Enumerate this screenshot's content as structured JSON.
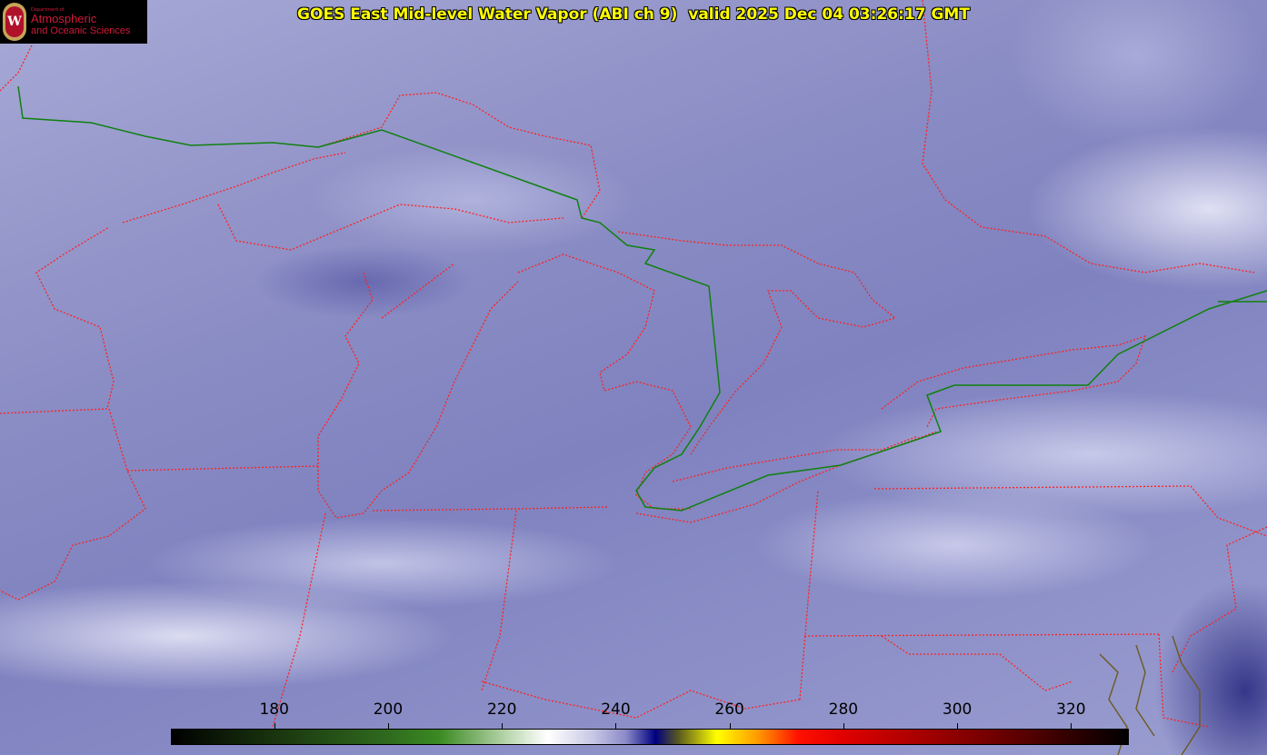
{
  "title": "GOES East Mid-level Water Vapor (ABI ch 9)  valid 2025 Dec 04 03:26:17 GMT",
  "logo": {
    "dept_line": "Department of",
    "line1": "Atmospheric",
    "line2": "and Oceanic Sciences",
    "seal_letter": "W"
  },
  "colorbar": {
    "units_min": 162,
    "units_max": 330,
    "ticks": [
      {
        "value": 180,
        "label": "180"
      },
      {
        "value": 200,
        "label": "200"
      },
      {
        "value": 220,
        "label": "220"
      },
      {
        "value": 240,
        "label": "240"
      },
      {
        "value": 260,
        "label": "260"
      },
      {
        "value": 280,
        "label": "280"
      },
      {
        "value": 300,
        "label": "300"
      },
      {
        "value": 320,
        "label": "320"
      }
    ]
  },
  "colors": {
    "state_border": "#ff2020",
    "country_border": "#108010",
    "coastline": "#6b5a20",
    "title_text": "#ffff00"
  }
}
